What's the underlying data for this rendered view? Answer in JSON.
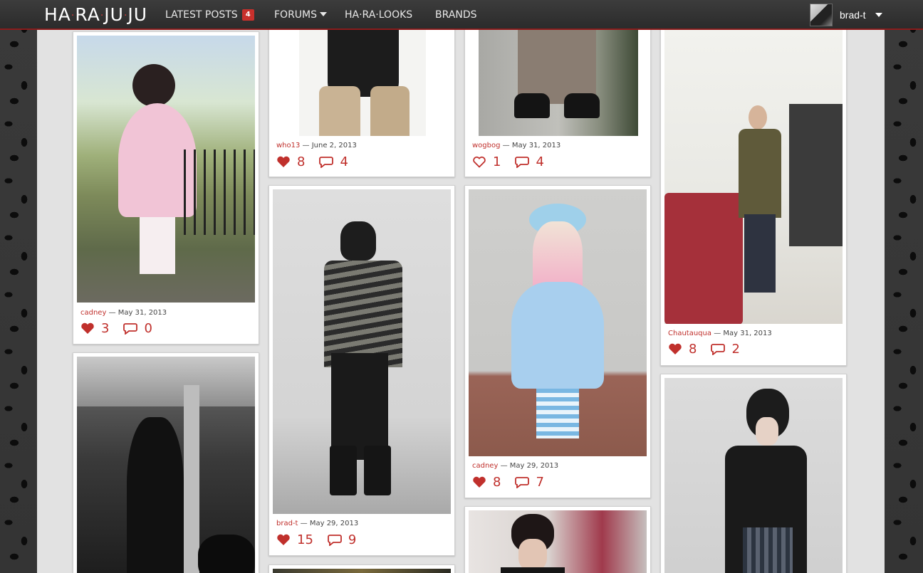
{
  "app": {
    "logo": [
      "HA",
      "RA",
      "JU",
      "JU"
    ]
  },
  "nav": {
    "latest_posts": "LATEST POSTS",
    "latest_posts_badge": "4",
    "forums": "FORUMS",
    "looks": "HA·RA·LOOKS",
    "brands": "BRANDS"
  },
  "user": {
    "name": "brad-t"
  },
  "colors": {
    "accent": "#c0302c",
    "topbar": "#2f2f2f",
    "card": "#ffffff"
  },
  "posts": [
    {
      "author": "cadney",
      "date": "— May 31, 2013",
      "likes": "3",
      "comments": "0",
      "liked": true
    },
    {
      "author": "who13",
      "date": "— June 2, 2013",
      "likes": "8",
      "comments": "4",
      "liked": true
    },
    {
      "author": "wogbog",
      "date": "— May 31, 2013",
      "likes": "1",
      "comments": "4",
      "liked": false
    },
    {
      "author": "Chautauqua",
      "date": "— May 31, 2013",
      "likes": "8",
      "comments": "2",
      "liked": true
    },
    {
      "author": "brad-t",
      "date": "— May 29, 2013",
      "likes": "15",
      "comments": "9",
      "liked": true
    },
    {
      "author": "cadney",
      "date": "— May 29, 2013",
      "likes": "8",
      "comments": "7",
      "liked": true
    }
  ]
}
